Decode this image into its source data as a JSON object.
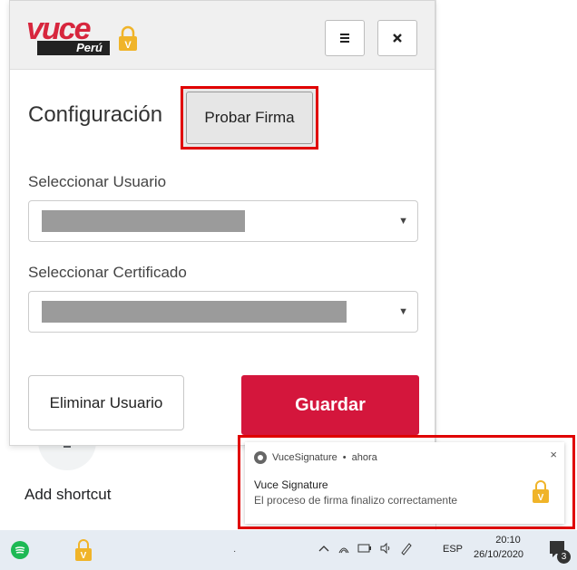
{
  "popup": {
    "logo": {
      "brand_word": "vuce",
      "country": "Perú"
    },
    "config_title": "Configuración",
    "probar_label": "Probar Firma",
    "user_label": "Seleccionar Usuario",
    "cert_label": "Seleccionar Certificado",
    "eliminar_label": "Eliminar Usuario",
    "guardar_label": "Guardar"
  },
  "newtab": {
    "add_shortcut_label": "Add shortcut"
  },
  "notification": {
    "app_name": "VuceSignature",
    "separator": "•",
    "time": "ahora",
    "close_glyph": "×",
    "title": "Vuce Signature",
    "body": "El proceso de firma finalizo correctamente"
  },
  "taskbar": {
    "language": "ESP",
    "time": "20:10",
    "date": "26/10/2020",
    "notification_count": "3"
  },
  "colors": {
    "brand_red": "#d4163c",
    "highlight_red": "#e00000",
    "lock_gold": "#f0b429"
  },
  "icons": [
    "menu-icon",
    "close-icon",
    "lock-icon",
    "chevron-down-icon",
    "chrome-icon",
    "spotify-icon",
    "network-icon",
    "battery-icon",
    "volume-icon",
    "pen-icon",
    "notification-icon"
  ]
}
